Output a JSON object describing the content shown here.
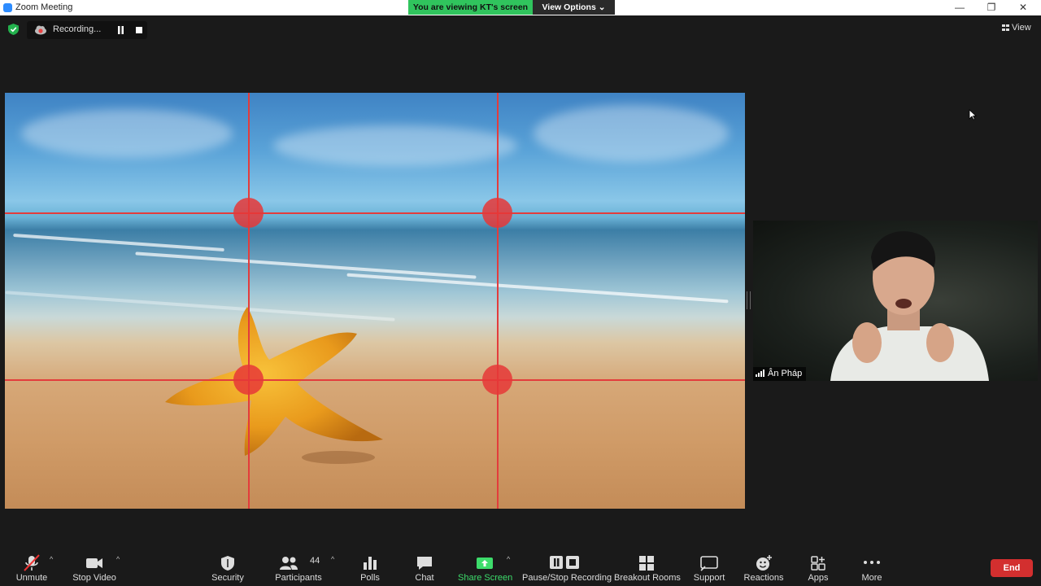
{
  "window": {
    "title": "Zoom Meeting",
    "min_icon": "—",
    "max_icon": "❐",
    "close_icon": "✕"
  },
  "banner": {
    "viewing_text": "You are viewing KT's screen",
    "view_options_label": "View Options ⌄"
  },
  "recording": {
    "status_text": "Recording..."
  },
  "view_button": {
    "label": "View"
  },
  "participant": {
    "name": "Ân Pháp"
  },
  "toolbar": {
    "unmute": "Unmute",
    "stop_video": "Stop Video",
    "security": "Security",
    "participants": "Participants",
    "participants_count": "44",
    "polls": "Polls",
    "chat": "Chat",
    "share_screen": "Share Screen",
    "pause_stop_recording": "Pause/Stop Recording",
    "breakout_rooms": "Breakout Rooms",
    "support": "Support",
    "reactions": "Reactions",
    "apps": "Apps",
    "more": "More",
    "end": "End",
    "caret": "^"
  },
  "colors": {
    "share_green": "#3ddc6b",
    "end_red": "#d32f2f",
    "banner_green": "#30c45d"
  }
}
